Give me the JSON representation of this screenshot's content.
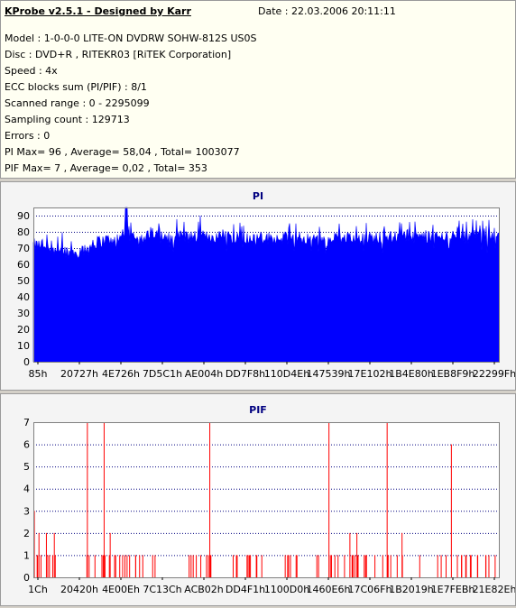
{
  "info": {
    "title": "KProbe v2.5.1 - Designed by Karr",
    "date": "Date : 22.03.2006 20:11:11",
    "lines": [
      "Model : 1-0-0-0 LITE-ON DVDRW SOHW-812S  US0S",
      "Disc : DVD+R , RITEKR03 [RiTEK Corporation]",
      "Speed : 4x",
      "ECC blocks sum (PI/PIF) : 8/1",
      "Scanned range : 0 - 2295099",
      "Sampling count : 129713",
      "Errors : 0",
      "PI Max= 96 , Average= 58,04 , Total= 1003077",
      "PIF Max= 7 , Average= 0,02 , Total= 353"
    ]
  },
  "chart_data": [
    {
      "type": "area",
      "title": "PI",
      "color": "#0000ff",
      "ylim": [
        0,
        95
      ],
      "yticks": [
        0,
        10,
        20,
        30,
        40,
        50,
        60,
        70,
        80,
        90
      ],
      "xticks": [
        "85h",
        "20727h",
        "4E726h",
        "7D5C1h",
        "AE004h",
        "DD7F8h",
        "110D4Eh",
        "147539h",
        "17E102h",
        "1B4E80h",
        "1EB8F9h",
        "22299Fh"
      ],
      "grid": true,
      "profile": [
        {
          "x": 0.0,
          "y": 72
        },
        {
          "x": 0.05,
          "y": 70
        },
        {
          "x": 0.08,
          "y": 67
        },
        {
          "x": 0.11,
          "y": 68
        },
        {
          "x": 0.14,
          "y": 74
        },
        {
          "x": 0.2,
          "y": 77
        },
        {
          "x": 0.3,
          "y": 77
        },
        {
          "x": 0.4,
          "y": 77
        },
        {
          "x": 0.5,
          "y": 76
        },
        {
          "x": 0.6,
          "y": 76
        },
        {
          "x": 0.7,
          "y": 76
        },
        {
          "x": 0.8,
          "y": 77
        },
        {
          "x": 0.9,
          "y": 77
        },
        {
          "x": 1.0,
          "y": 78
        }
      ],
      "max": 96
    },
    {
      "type": "bar",
      "title": "PIF",
      "color": "#ff0000",
      "ylim": [
        0,
        7
      ],
      "yticks": [
        0,
        1,
        2,
        3,
        4,
        5,
        6,
        7
      ],
      "xticks": [
        "1Ch",
        "20420h",
        "4E00Eh",
        "7C13Ch",
        "ACB02h",
        "DD4F1h",
        "1100D0h",
        "1460E6h",
        "17C06Fh",
        "1B2019h",
        "1E7FEBh",
        "21E82Eh"
      ],
      "grid": true,
      "spikes": [
        {
          "x": 0.002,
          "y": 3
        },
        {
          "x": 0.012,
          "y": 2
        },
        {
          "x": 0.028,
          "y": 2
        },
        {
          "x": 0.045,
          "y": 2
        },
        {
          "x": 0.116,
          "y": 7
        },
        {
          "x": 0.152,
          "y": 7
        },
        {
          "x": 0.165,
          "y": 2
        },
        {
          "x": 0.35,
          "y": 1
        },
        {
          "x": 0.379,
          "y": 7
        },
        {
          "x": 0.635,
          "y": 7
        },
        {
          "x": 0.68,
          "y": 2
        },
        {
          "x": 0.695,
          "y": 2
        },
        {
          "x": 0.76,
          "y": 7
        },
        {
          "x": 0.792,
          "y": 2
        },
        {
          "x": 0.83,
          "y": 1
        },
        {
          "x": 0.898,
          "y": 6
        },
        {
          "x": 1.16,
          "y": 7
        }
      ]
    }
  ]
}
